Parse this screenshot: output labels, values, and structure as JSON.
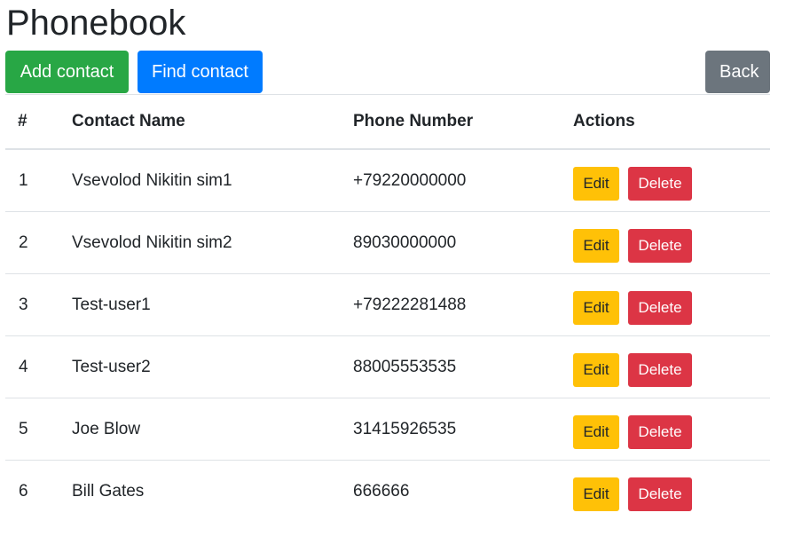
{
  "page": {
    "title": "Phonebook"
  },
  "toolbar": {
    "add_label": "Add contact",
    "find_label": "Find contact",
    "back_label": "Back"
  },
  "table": {
    "headers": [
      "#",
      "Contact Name",
      "Phone Number",
      "Actions"
    ],
    "edit_label": "Edit",
    "delete_label": "Delete",
    "rows": [
      {
        "num": "1",
        "name": "Vsevolod Nikitin sim1",
        "phone": "+79220000000"
      },
      {
        "num": "2",
        "name": "Vsevolod Nikitin sim2",
        "phone": "89030000000"
      },
      {
        "num": "3",
        "name": "Test-user1",
        "phone": "+79222281488"
      },
      {
        "num": "4",
        "name": "Test-user2",
        "phone": "88005553535"
      },
      {
        "num": "5",
        "name": "Joe Blow",
        "phone": "31415926535"
      },
      {
        "num": "6",
        "name": "Bill Gates",
        "phone": "666666"
      }
    ]
  },
  "colors": {
    "add": "#28a745",
    "find": "#007bff",
    "back": "#6c757d",
    "edit": "#ffc107",
    "delete": "#dc3545",
    "border": "#dee2e6",
    "text": "#212529"
  }
}
